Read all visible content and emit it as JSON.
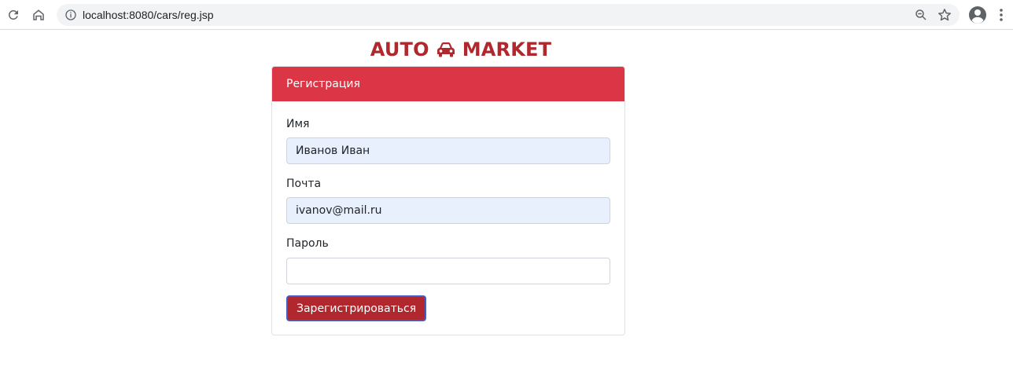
{
  "browser": {
    "url": "localhost:8080/cars/reg.jsp",
    "icons": [
      "reload-icon",
      "home-icon",
      "info-icon",
      "zoom-icon",
      "star-icon",
      "account-icon",
      "menu-icon"
    ]
  },
  "brand": {
    "left_text": "AUTO",
    "right_text": "MARKET",
    "icon": "car-icon",
    "color": "#b0282d"
  },
  "form": {
    "header": "Регистрация",
    "header_color": "#dc3545",
    "fields": [
      {
        "label": "Имя",
        "value": "Иванов Иван"
      },
      {
        "label": "Почта",
        "value": "ivanov@mail.ru"
      },
      {
        "label": "Пароль",
        "value": ""
      }
    ],
    "submit_label": "Зарегистрироваться",
    "submit_color": "#b0282d"
  }
}
